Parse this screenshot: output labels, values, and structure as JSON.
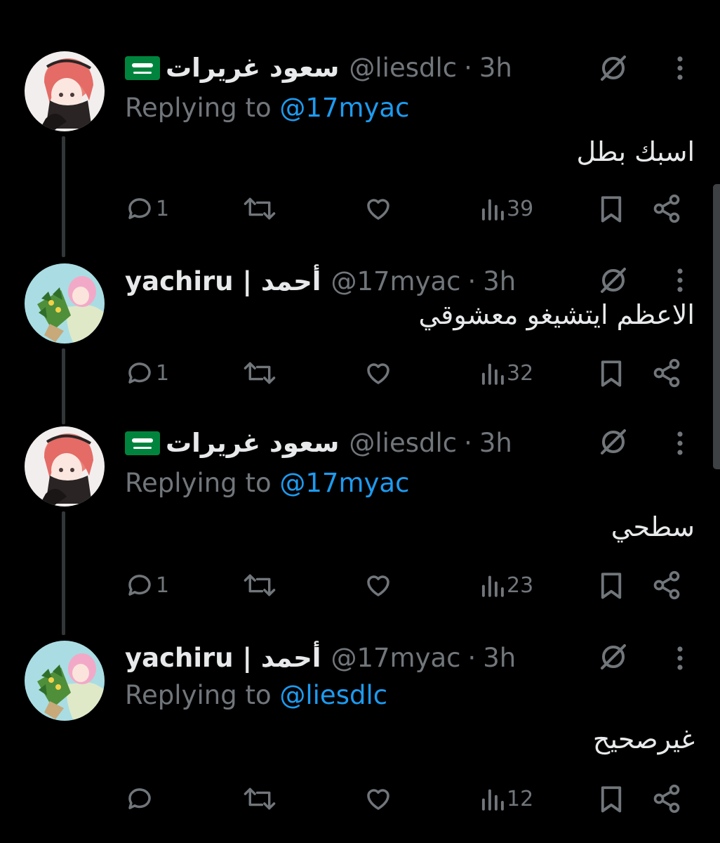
{
  "thread": [
    {
      "author_name": "سعود غريرات",
      "has_flag": true,
      "handle": "@liesdlc",
      "separator": "·",
      "time": "3h",
      "replying_prefix": "Replying to",
      "replying_to": "@17myac",
      "text": "اسبك بطل",
      "replies": "1",
      "views": "39"
    },
    {
      "author_name": "yachiru | أحمد",
      "has_flag": false,
      "handle": "@17myac",
      "separator": "·",
      "time": "3h",
      "text": "الاعظم ايتشيغو معشوقي",
      "replies": "1",
      "views": "32"
    },
    {
      "author_name": "سعود غريرات",
      "has_flag": true,
      "handle": "@liesdlc",
      "separator": "·",
      "time": "3h",
      "replying_prefix": "Replying to",
      "replying_to": "@17myac",
      "text": "سطحي",
      "replies": "1",
      "views": "23"
    },
    {
      "author_name": "yachiru | أحمد",
      "has_flag": false,
      "handle": "@17myac",
      "separator": "·",
      "time": "3h",
      "replying_prefix": "Replying to",
      "replying_to": "@liesdlc",
      "text": "غيرصحيح",
      "replies": "",
      "views": "12"
    }
  ],
  "icons": {
    "grok": "grok-icon",
    "more": "more-options-icon",
    "reply": "reply-icon",
    "retweet": "retweet-icon",
    "like": "like-heart-icon",
    "views": "views-icon",
    "bookmark": "bookmark-icon",
    "share": "share-icon"
  },
  "colors": {
    "background": "#000000",
    "text_primary": "#e7e9ea",
    "text_secondary": "#71767b",
    "accent": "#1d9bf0",
    "thread_line": "#333639",
    "flag_green": "#00843d"
  }
}
